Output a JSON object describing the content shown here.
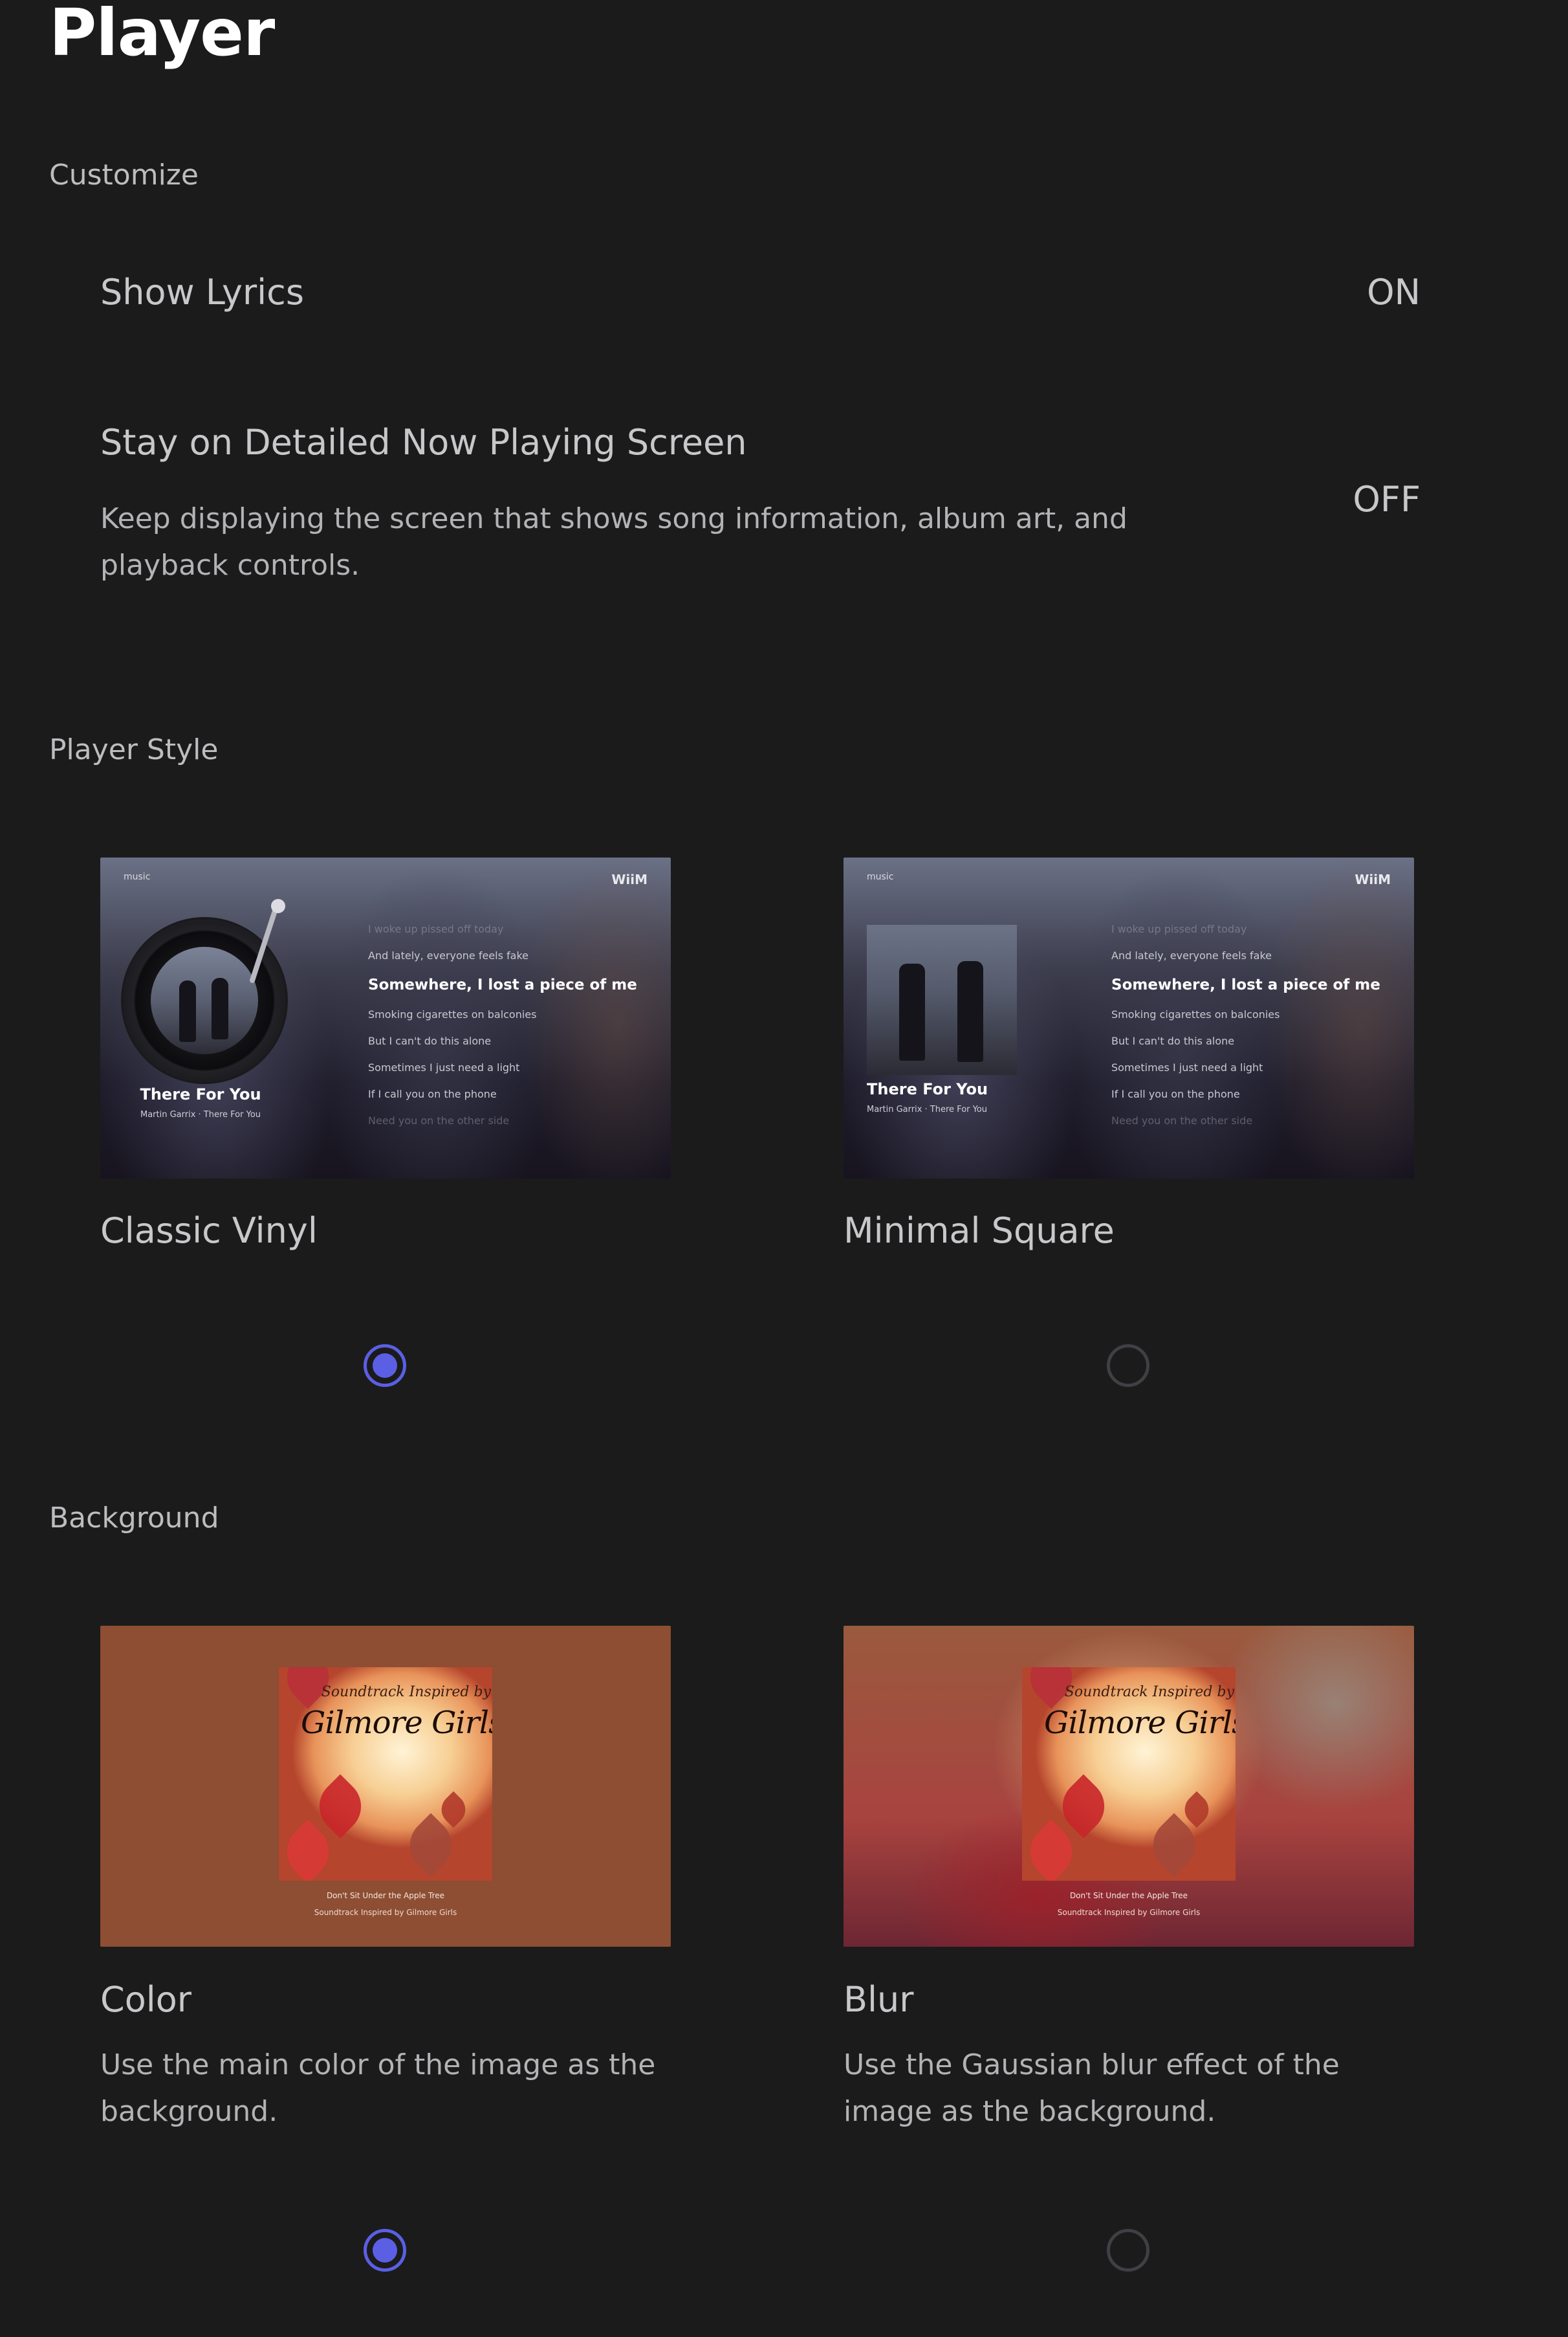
{
  "page_title": "Player",
  "customize": {
    "title": "Customize",
    "show_lyrics": {
      "label": "Show Lyrics",
      "value": "ON"
    },
    "stay_on_detailed": {
      "label": "Stay on Detailed Now Playing Screen",
      "description": "Keep displaying the screen that shows song information, album art, and playback controls.",
      "value": "OFF"
    }
  },
  "player_style": {
    "title": "Player Style",
    "preview": {
      "brand_left": "music",
      "brand_right": "WiiM",
      "song_title": "There For You",
      "song_subtitle": "Martin Garrix · There For You",
      "lyrics": [
        "I woke up pissed off today",
        "And lately, everyone feels fake",
        "Somewhere, I lost a piece of me",
        "Smoking cigarettes on balconies",
        "But I can't do this alone",
        "Sometimes I just need a light",
        "If I call you on the phone",
        "Need you on the other side"
      ]
    },
    "options": [
      {
        "label": "Classic Vinyl",
        "selected": true
      },
      {
        "label": "Minimal Square",
        "selected": false
      }
    ]
  },
  "background": {
    "title": "Background",
    "preview": {
      "album_top": "Soundtrack Inspired by",
      "album_title": "Gilmore Girls",
      "caption_song": "Don't Sit Under the Apple Tree",
      "caption_album": "Soundtrack Inspired by Gilmore Girls"
    },
    "options": [
      {
        "label": "Color",
        "description": "Use the main color of the image as the background.",
        "selected": true
      },
      {
        "label": "Blur",
        "description": "Use the Gaussian blur effect of the image as the background.",
        "selected": false
      }
    ]
  },
  "colors": {
    "accent": "#5b5fe3",
    "background": "#1b1b1c",
    "color_bg_sample": "#8d4e33"
  }
}
